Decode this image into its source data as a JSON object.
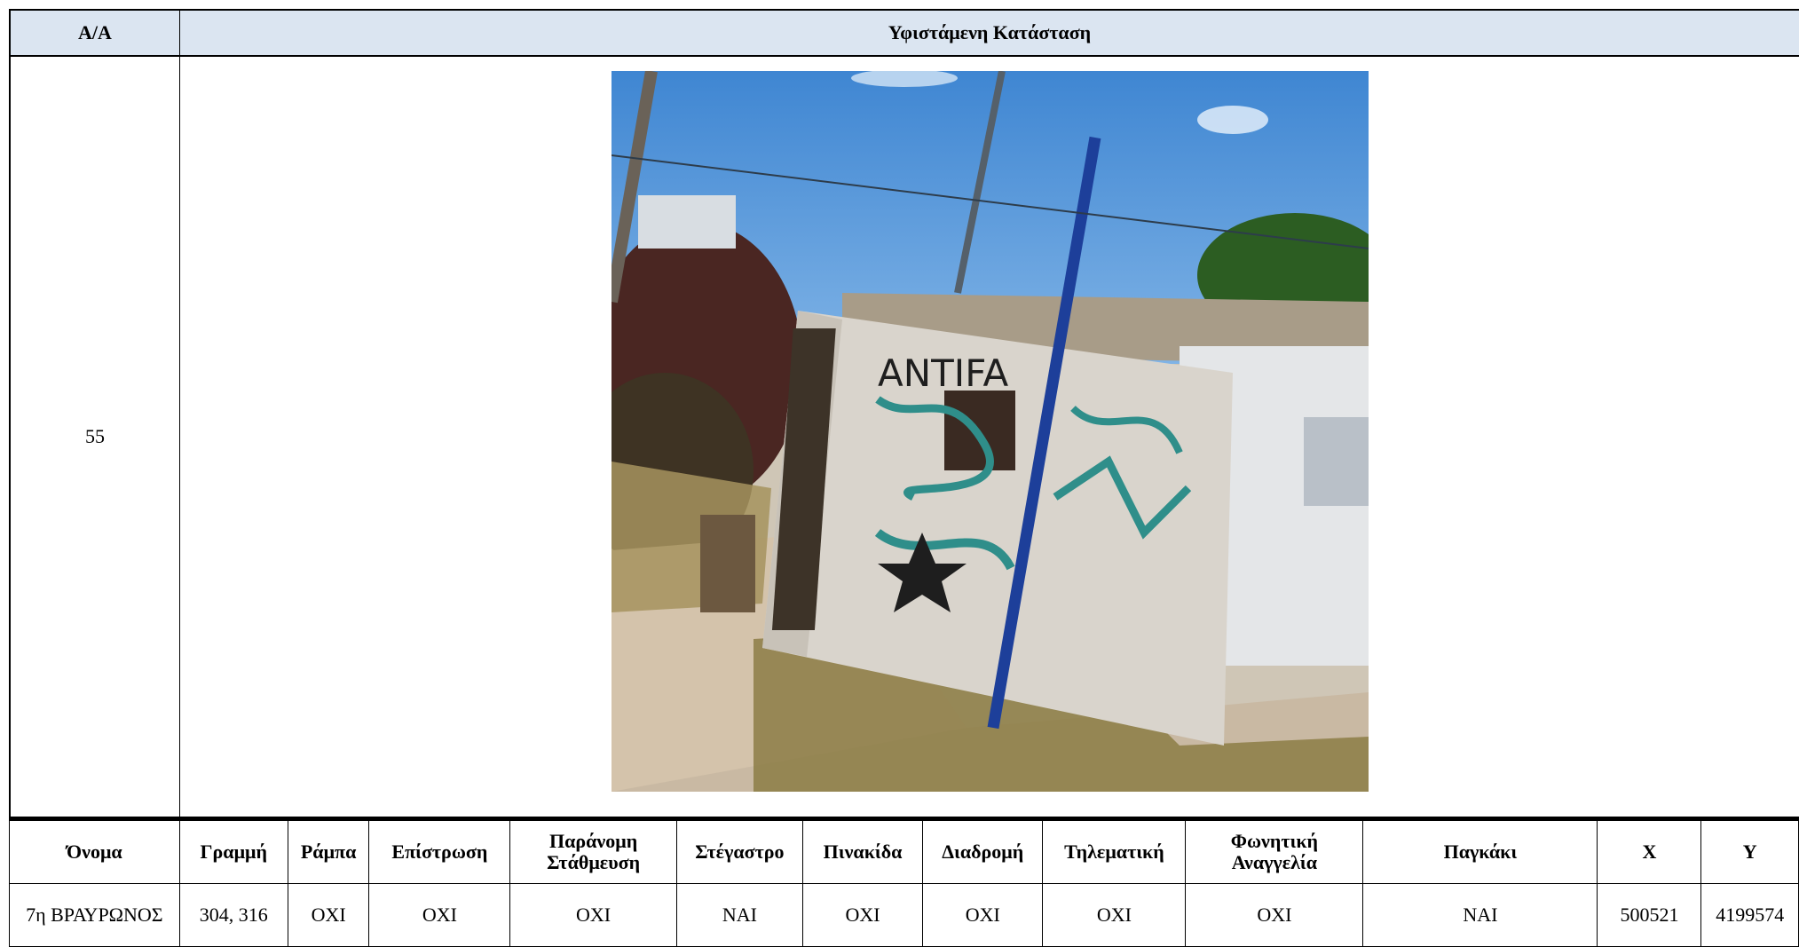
{
  "header": {
    "aa_label": "Α/Α",
    "state_label": "Υφιστάμενη Κατάσταση"
  },
  "row_number": "55",
  "photo": {
    "graffiti_text": "ANTIFA",
    "colors": {
      "sky": "#4a8fd6",
      "wall": "#d9d4cc",
      "graffiti": "#2f8e8a",
      "pole": "#1d3f9a"
    }
  },
  "columns": [
    "Όνομα",
    "Γραμμή",
    "Ράμπα",
    "Επίστρωση",
    "Παράνομη Στάθμευση",
    "Στέγαστρο",
    "Πινακίδα",
    "Διαδρομή",
    "Τηλεματική",
    "Φωνητική Αναγγελία",
    "Παγκάκι",
    "Χ",
    "Υ"
  ],
  "values": [
    "7η ΒΡΑΥΡΩΝΟΣ",
    "304, 316",
    "ΟΧΙ",
    "ΟΧΙ",
    "ΟΧΙ",
    "ΝΑΙ",
    "ΟΧΙ",
    "ΟΧΙ",
    "ΟΧΙ",
    "ΟΧΙ",
    "ΝΑΙ",
    "500521",
    "4199574"
  ]
}
